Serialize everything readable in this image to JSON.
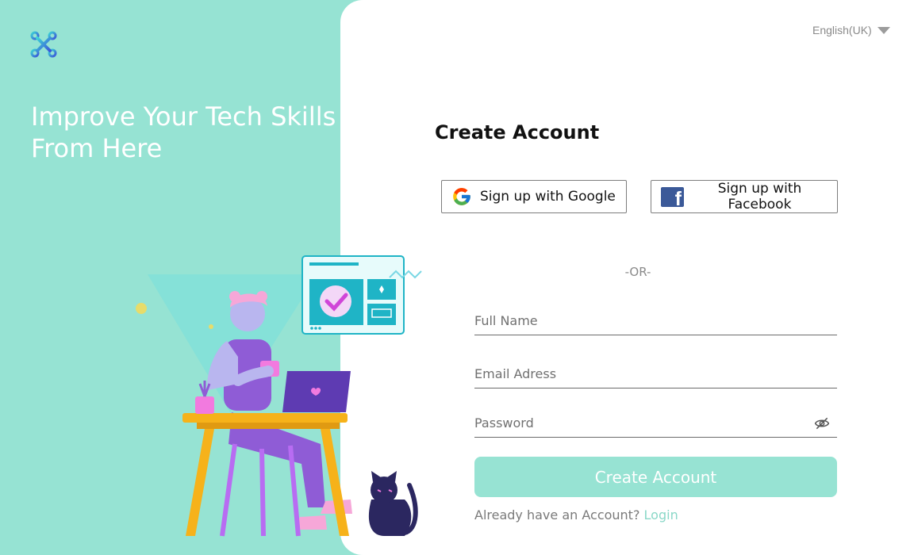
{
  "brand": {
    "logo_icon": "x-logo-icon",
    "headline_line1": "Improve Your Tech Skills",
    "headline_line2": "From Here",
    "accent": "#96e3d3"
  },
  "language": {
    "selected": "English(UK)"
  },
  "form": {
    "title": "Create Account",
    "google_label": "Sign up with Google",
    "facebook_label": "Sign up with Facebook",
    "or_label": "-OR-",
    "full_name_placeholder": "Full Name",
    "email_placeholder": "Email Adress",
    "password_placeholder": "Password",
    "submit_label": "Create Account",
    "already_text": "Already have an Account?",
    "login_label": "Login"
  }
}
